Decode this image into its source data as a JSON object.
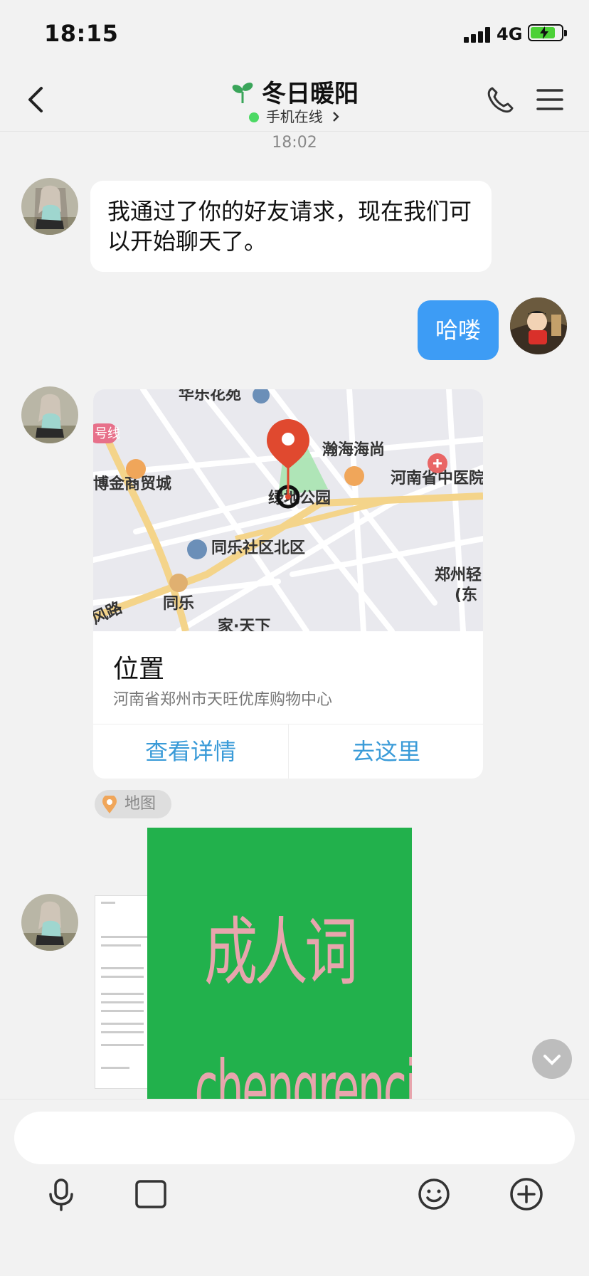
{
  "status_bar": {
    "time": "18:15",
    "network": "4G",
    "battery_charging": true
  },
  "header": {
    "title": "冬日暖阳",
    "subtitle": "手机在线",
    "icons": [
      "back-icon",
      "sprout-icon",
      "phone-icon",
      "menu-icon"
    ]
  },
  "chat": {
    "timestamp": "18:02",
    "messages": [
      {
        "side": "left",
        "type": "text",
        "text": "我通过了你的好友请求，现在我们可以开始聊天了。"
      },
      {
        "side": "right",
        "type": "text",
        "text": "哈喽"
      },
      {
        "side": "left",
        "type": "location",
        "map_labels": [
          "华乐花苑",
          "瀚海海尚",
          "河南省中医院",
          "博金商贸城",
          "绿地公园",
          "同乐社区北区",
          "郑州轻",
          "(东",
          "同乐",
          "风路",
          "号线",
          "家·天下"
        ],
        "title": "位置",
        "address": "河南省郑州市天旺优库购物中心",
        "actions": [
          "查看详情",
          "去这里"
        ],
        "tag": "地图"
      },
      {
        "side": "left",
        "type": "image"
      }
    ]
  },
  "watermark": {
    "cn": "成人词",
    "en": "chengrenci.com"
  },
  "input": {
    "placeholder": ""
  },
  "toolbar": {
    "icons": [
      "mic-icon",
      "image-icon",
      "camera-icon",
      "redpacket-icon",
      "emoji-icon",
      "plus-icon"
    ]
  },
  "colors": {
    "bubble_out": "#3d9cf5",
    "online": "#4cd964",
    "link": "#3a9bd8",
    "watermark_bg": "#22b14c",
    "pin": "#e0492f"
  }
}
